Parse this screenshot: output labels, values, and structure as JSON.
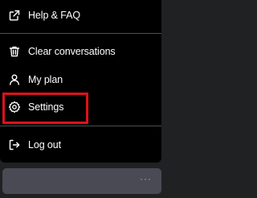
{
  "menu": {
    "items": [
      {
        "label": "Help & FAQ",
        "icon": "external-link-icon"
      },
      {
        "label": "Clear conversations",
        "icon": "trash-icon"
      },
      {
        "label": "My plan",
        "icon": "user-icon"
      },
      {
        "label": "Settings",
        "icon": "gear-icon"
      },
      {
        "label": "Log out",
        "icon": "logout-icon"
      }
    ]
  },
  "user_bar": {
    "more_symbol": "···"
  },
  "colors": {
    "menu_background": "#000000",
    "page_background": "#202123",
    "highlight_border": "#e0101a",
    "user_bar_background": "#4a4a55"
  }
}
